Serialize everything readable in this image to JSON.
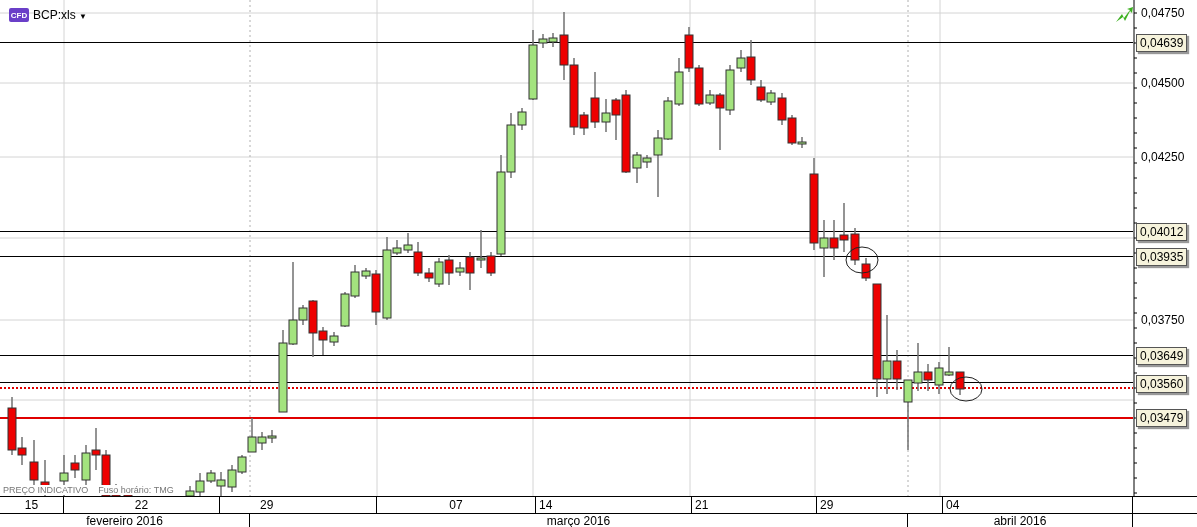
{
  "header": {
    "icon_label": "CFD",
    "symbol": "BCP:xls",
    "caret": "▼"
  },
  "chart_notes": [
    "PREÇO INDICATIVO",
    "Fuso horário: TMG"
  ],
  "price_axis": {
    "ticks": [
      "0,04750",
      "0,04500",
      "0,04250",
      "0,03750"
    ]
  },
  "levels": [
    {
      "label": "0,04639",
      "color": "#000000",
      "kind": "level"
    },
    {
      "label": "0,04012",
      "color": "#000000",
      "kind": "level"
    },
    {
      "label": "0,03935",
      "color": "#000000",
      "kind": "level"
    },
    {
      "label": "0,03649",
      "color": "#000000",
      "kind": "level"
    },
    {
      "label": "0,03560",
      "color": "#e00000",
      "kind": "price"
    },
    {
      "label": "0,03479",
      "color": "#e00000",
      "kind": "level"
    }
  ],
  "days": [
    "15",
    "22",
    "29",
    "07",
    "14",
    "21",
    "29",
    "04"
  ],
  "months": [
    "fevereiro 2016",
    "março 2016",
    "abril 2016"
  ]
}
